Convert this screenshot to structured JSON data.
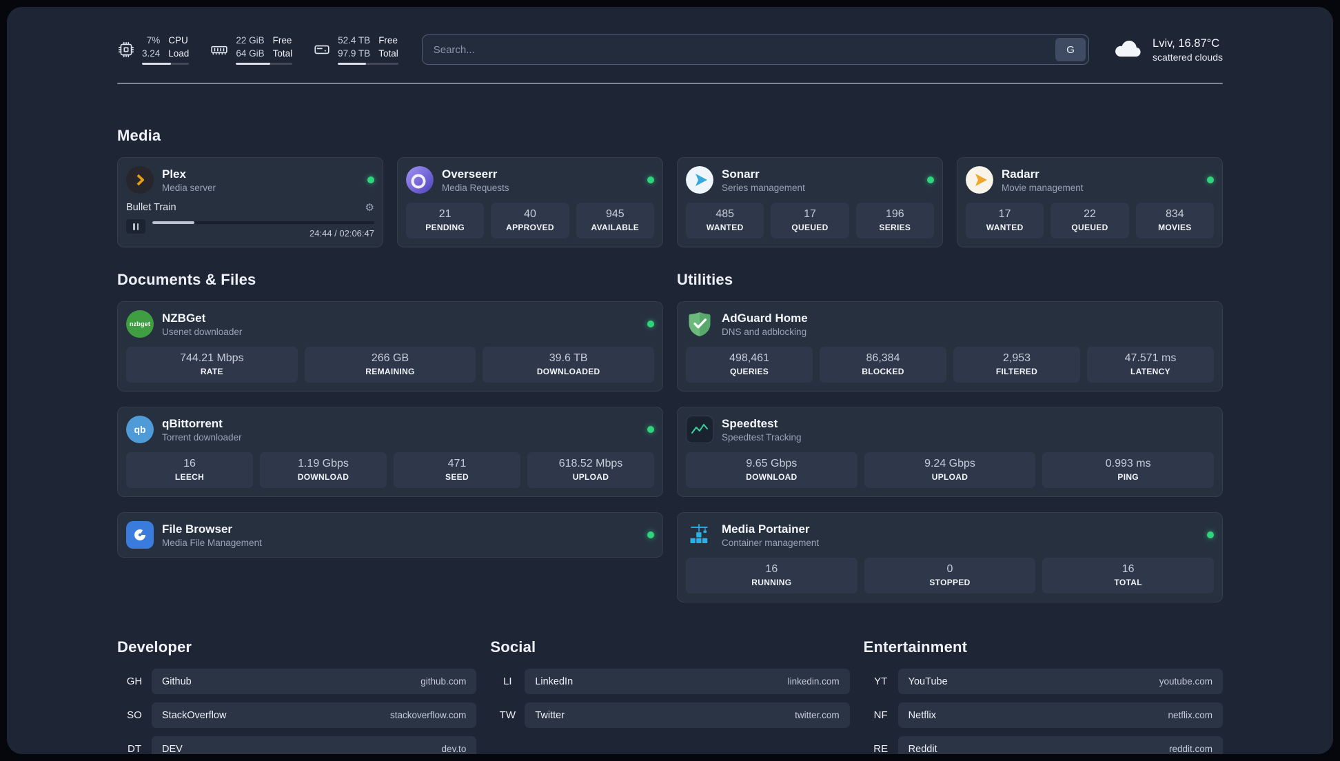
{
  "colors": {
    "background": "#1e2636",
    "card": "#27303f",
    "stat_box": "#2e384a",
    "online_dot": "#2fd57c",
    "speedtest_line": "#37d39b",
    "plex_gold": "#e5a00d",
    "portainer_blue": "#29b2e8"
  },
  "icons": {
    "gear": "⚙",
    "nzbget_logo_text": "nzbget",
    "qbittorrent_logo_text": "qb"
  },
  "topbar": {
    "cpu": {
      "value1": "7%",
      "label1": "CPU",
      "value2": "3.24",
      "label2": "Load",
      "bar_percent": 62
    },
    "memory": {
      "value1": "22 GiB",
      "label1": "Free",
      "value2": "64 GiB",
      "label2": "Total",
      "bar_percent": 61
    },
    "disk": {
      "value1": "52.4 TB",
      "label1": "Free",
      "value2": "97.9 TB",
      "label2": "Total",
      "bar_percent": 47
    },
    "search": {
      "placeholder": "Search...",
      "button_label": "G"
    },
    "weather": {
      "location": "Lviv, 16.87°C",
      "condition": "scattered clouds"
    }
  },
  "media": {
    "title": "Media",
    "plex": {
      "name": "Plex",
      "desc": "Media server",
      "now_playing": {
        "title": "Bullet Train",
        "time": "24:44 / 02:06:47",
        "progress_percent": 19
      }
    },
    "overseerr": {
      "name": "Overseerr",
      "desc": "Media Requests",
      "stats": [
        {
          "value": "21",
          "label": "PENDING"
        },
        {
          "value": "40",
          "label": "APPROVED"
        },
        {
          "value": "945",
          "label": "AVAILABLE"
        }
      ]
    },
    "sonarr": {
      "name": "Sonarr",
      "desc": "Series management",
      "stats": [
        {
          "value": "485",
          "label": "WANTED"
        },
        {
          "value": "17",
          "label": "QUEUED"
        },
        {
          "value": "196",
          "label": "SERIES"
        }
      ]
    },
    "radarr": {
      "name": "Radarr",
      "desc": "Movie management",
      "stats": [
        {
          "value": "17",
          "label": "WANTED"
        },
        {
          "value": "22",
          "label": "QUEUED"
        },
        {
          "value": "834",
          "label": "MOVIES"
        }
      ]
    }
  },
  "documents": {
    "title": "Documents & Files",
    "nzbget": {
      "name": "NZBGet",
      "desc": "Usenet downloader",
      "stats": [
        {
          "value": "744.21 Mbps",
          "label": "RATE"
        },
        {
          "value": "266 GB",
          "label": "REMAINING"
        },
        {
          "value": "39.6 TB",
          "label": "DOWNLOADED"
        }
      ]
    },
    "qbittorrent": {
      "name": "qBittorrent",
      "desc": "Torrent downloader",
      "stats": [
        {
          "value": "16",
          "label": "LEECH"
        },
        {
          "value": "1.19 Gbps",
          "label": "DOWNLOAD"
        },
        {
          "value": "471",
          "label": "SEED"
        },
        {
          "value": "618.52 Mbps",
          "label": "UPLOAD"
        }
      ]
    },
    "filebrowser": {
      "name": "File Browser",
      "desc": "Media File Management"
    }
  },
  "utilities": {
    "title": "Utilities",
    "adguard": {
      "name": "AdGuard Home",
      "desc": "DNS and adblocking",
      "stats": [
        {
          "value": "498,461",
          "label": "QUERIES"
        },
        {
          "value": "86,384",
          "label": "BLOCKED"
        },
        {
          "value": "2,953",
          "label": "FILTERED"
        },
        {
          "value": "47.571 ms",
          "label": "LATENCY"
        }
      ]
    },
    "speedtest": {
      "name": "Speedtest",
      "desc": "Speedtest Tracking",
      "stats": [
        {
          "value": "9.65 Gbps",
          "label": "DOWNLOAD"
        },
        {
          "value": "9.24 Gbps",
          "label": "UPLOAD"
        },
        {
          "value": "0.993 ms",
          "label": "PING"
        }
      ]
    },
    "portainer": {
      "name": "Media Portainer",
      "desc": "Container management",
      "stats": [
        {
          "value": "16",
          "label": "RUNNING"
        },
        {
          "value": "0",
          "label": "STOPPED"
        },
        {
          "value": "16",
          "label": "TOTAL"
        }
      ]
    }
  },
  "bookmarks": {
    "developer": {
      "title": "Developer",
      "items": [
        {
          "abbr": "GH",
          "name": "Github",
          "url": "github.com"
        },
        {
          "abbr": "SO",
          "name": "StackOverflow",
          "url": "stackoverflow.com"
        },
        {
          "abbr": "DT",
          "name": "DEV",
          "url": "dev.to"
        }
      ]
    },
    "social": {
      "title": "Social",
      "items": [
        {
          "abbr": "LI",
          "name": "LinkedIn",
          "url": "linkedin.com"
        },
        {
          "abbr": "TW",
          "name": "Twitter",
          "url": "twitter.com"
        }
      ]
    },
    "entertainment": {
      "title": "Entertainment",
      "items": [
        {
          "abbr": "YT",
          "name": "YouTube",
          "url": "youtube.com"
        },
        {
          "abbr": "NF",
          "name": "Netflix",
          "url": "netflix.com"
        },
        {
          "abbr": "RE",
          "name": "Reddit",
          "url": "reddit.com"
        }
      ]
    }
  }
}
